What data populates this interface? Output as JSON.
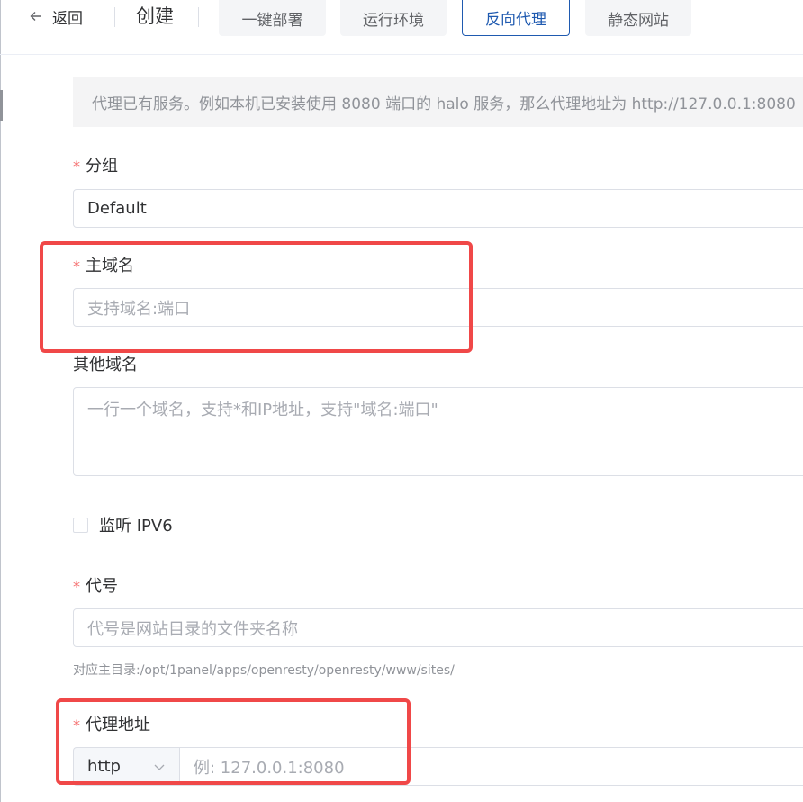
{
  "header": {
    "back_label": "返回",
    "title": "创建",
    "tabs": [
      {
        "label": "一键部署",
        "active": false
      },
      {
        "label": "运行环境",
        "active": false
      },
      {
        "label": "反向代理",
        "active": true
      },
      {
        "label": "静态网站",
        "active": false
      }
    ]
  },
  "alert": {
    "text": "代理已有服务。例如本机已安装使用 8080 端口的 halo 服务，那么代理地址为 http://127.0.0.1:8080"
  },
  "form": {
    "group": {
      "label": "分组",
      "value": "Default"
    },
    "primary_domain": {
      "label": "主域名",
      "placeholder": "支持域名:端口"
    },
    "other_domains": {
      "label": "其他域名",
      "placeholder": "一行一个域名，支持*和IP地址，支持\"域名:端口\""
    },
    "ipv6": {
      "label": "监听 IPV6",
      "checked": false
    },
    "alias": {
      "label": "代号",
      "placeholder": "代号是网站目录的文件夹名称",
      "hint": "对应主目录:/opt/1panel/apps/openresty/openresty/www/sites/"
    },
    "proxy": {
      "label": "代理地址",
      "protocol": "http",
      "placeholder": "例: 127.0.0.1:8080"
    },
    "required_mark": "*"
  },
  "colors": {
    "accent": "#1f5ab0",
    "required": "#f56c6c",
    "highlight": "#f04848"
  }
}
